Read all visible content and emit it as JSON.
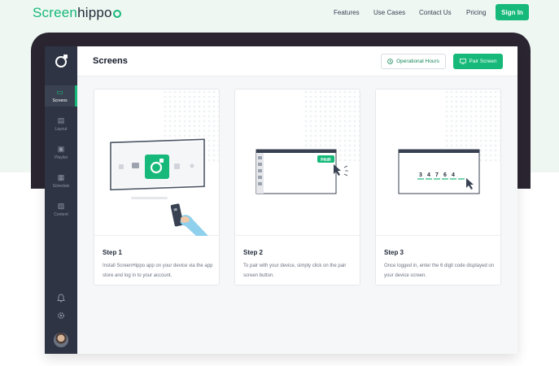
{
  "site": {
    "logo_part1": "Screen",
    "logo_part2": "hippo",
    "nav": [
      "Features",
      "Use Cases",
      "Contact Us",
      "Pricing"
    ],
    "signin_label": "Sign In"
  },
  "sidebar": {
    "items": [
      {
        "label": "Screens",
        "icon": "screen-icon",
        "active": true
      },
      {
        "label": "Layout",
        "icon": "layout-icon",
        "active": false
      },
      {
        "label": "Playlist",
        "icon": "playlist-icon",
        "active": false
      },
      {
        "label": "Schedule",
        "icon": "calendar-icon",
        "active": false
      },
      {
        "label": "Content",
        "icon": "image-icon",
        "active": false
      }
    ],
    "bottom_icons": [
      "bell-icon",
      "gear-icon",
      "avatar"
    ]
  },
  "header": {
    "title": "Screens",
    "operational_hours_label": "Operational Hours",
    "pair_screen_label": "Pair Screen"
  },
  "steps": [
    {
      "title": "Step 1",
      "desc": "Install ScreenHippo app on your device via the app store and log in to your account."
    },
    {
      "title": "Step 2",
      "desc": "To pair with your device, simply click on the pair screen button."
    },
    {
      "title": "Step 3",
      "desc": "Once logged in, enter the 6 digit code displayed on your device screen."
    }
  ],
  "illustrations": {
    "pair_badge": "PAIR",
    "code_digits": [
      "3",
      "4",
      "7",
      "6",
      "4"
    ]
  },
  "colors": {
    "accent": "#16b979",
    "sidebar": "#2e3444",
    "laptop": "#2a2530",
    "hero_bg": "#eef7f2"
  }
}
